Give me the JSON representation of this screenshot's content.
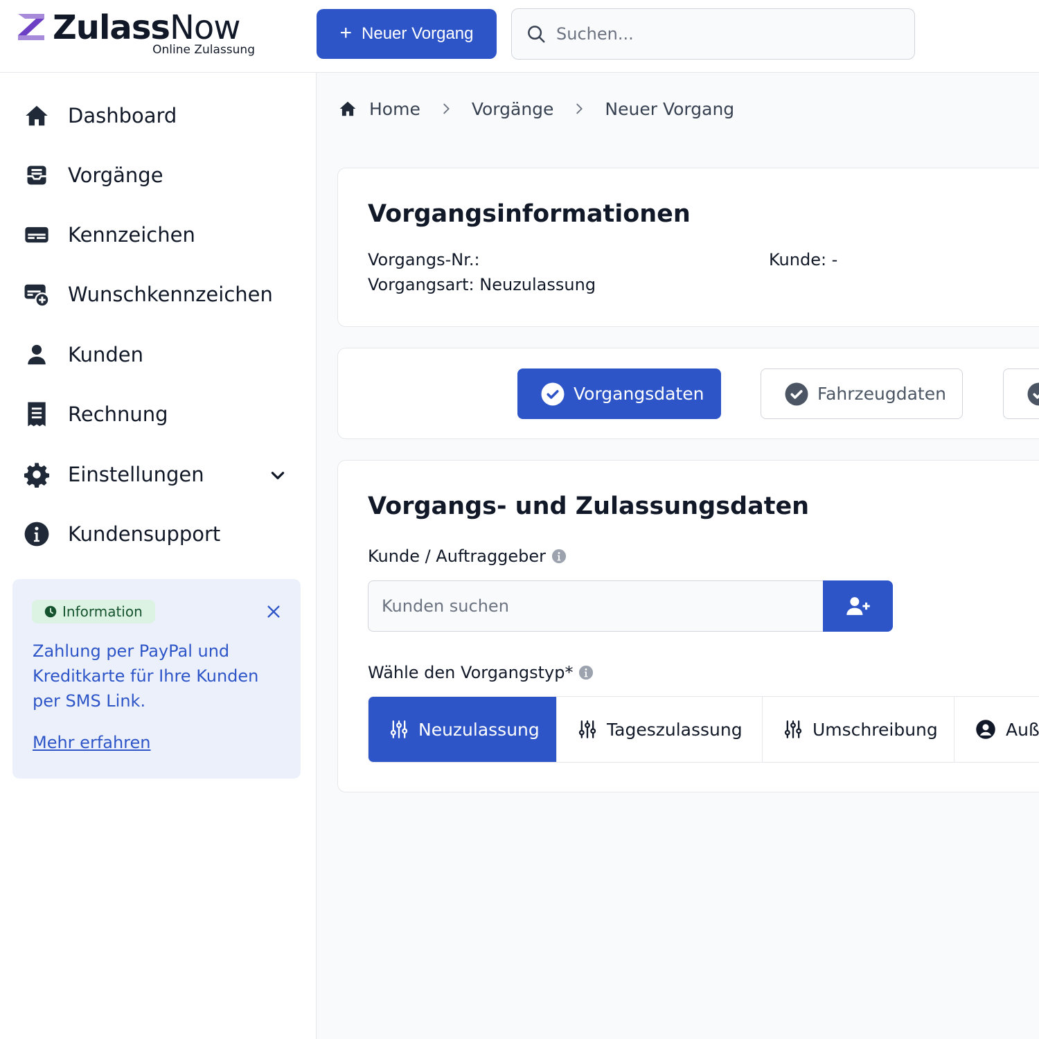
{
  "header": {
    "logo_bold": "Zulass",
    "logo_light": "Now",
    "logo_sub": "Online Zulassung",
    "new_button": "Neuer Vorgang",
    "search_placeholder": "Suchen...",
    "accent": "#2d55c8"
  },
  "sidebar": {
    "items": [
      {
        "label": "Dashboard",
        "icon": "home-icon"
      },
      {
        "label": "Vorgänge",
        "icon": "inbox-icon"
      },
      {
        "label": "Kennzeichen",
        "icon": "license-plate-icon"
      },
      {
        "label": "Wunschkennzeichen",
        "icon": "plate-add-icon"
      },
      {
        "label": "Kunden",
        "icon": "user-icon"
      },
      {
        "label": "Rechnung",
        "icon": "receipt-icon"
      },
      {
        "label": "Einstellungen",
        "icon": "gear-icon"
      },
      {
        "label": "Kundensupport",
        "icon": "info-icon"
      }
    ],
    "info": {
      "badge": "Information",
      "text": "Zahlung per PayPal und Kreditkarte für Ihre Kunden per SMS Link.",
      "link": "Mehr erfahren"
    }
  },
  "breadcrumb": [
    "Home",
    "Vorgänge",
    "Neuer Vorgang"
  ],
  "vorgangsinfo": {
    "title": "Vorgangsinformationen",
    "nr_label": "Vorgangs-Nr.:",
    "art_label": "Vorgangsart: Neuzulassung",
    "kunde_label": "Kunde: -"
  },
  "steps": [
    {
      "label": "Vorgangsdaten",
      "active": true
    },
    {
      "label": "Fahrzeugdaten",
      "active": false
    },
    {
      "label": "",
      "active": false
    }
  ],
  "zulassung": {
    "title": "Vorgangs- und Zulassungsdaten",
    "customer_label": "Kunde / Auftraggeber",
    "customer_placeholder": "Kunden suchen",
    "type_label": "Wähle den Vorgangstyp*",
    "types": [
      {
        "label": "Neuzulassung",
        "icon": "sliders-icon",
        "active": true
      },
      {
        "label": "Tageszulassung",
        "icon": "sliders-icon",
        "active": false
      },
      {
        "label": "Umschreibung",
        "icon": "sliders-icon",
        "active": false
      },
      {
        "label": "Auß",
        "icon": "user-circle-icon",
        "active": false
      }
    ]
  }
}
